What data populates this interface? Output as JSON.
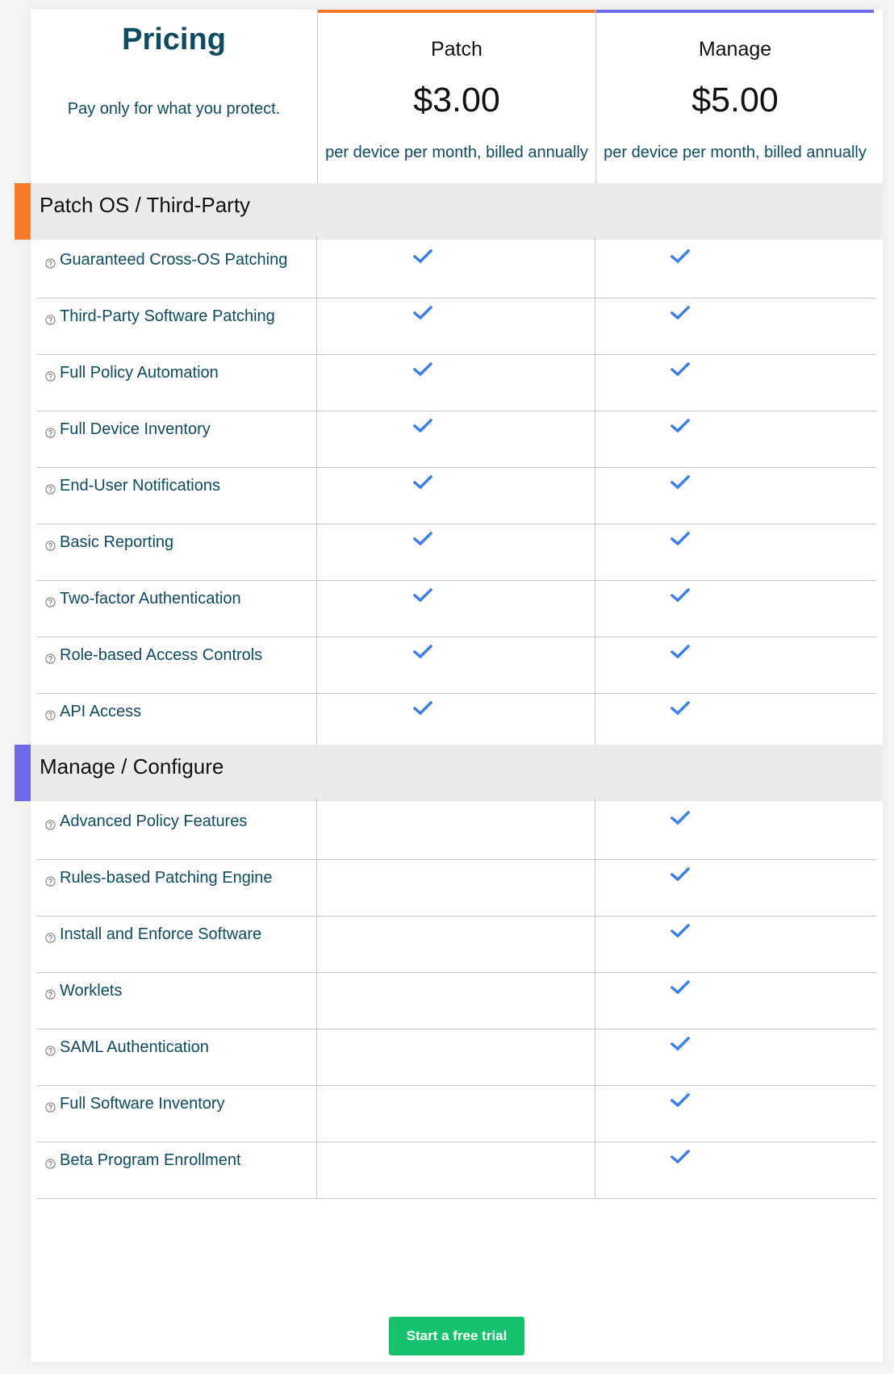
{
  "header": {
    "title": "Pricing",
    "subtitle": "Pay only for what you protect."
  },
  "plans": [
    {
      "name": "Patch",
      "price": "$3.00",
      "note": "per device per month, billed annually",
      "accent": "#f97a2a"
    },
    {
      "name": "Manage",
      "price": "$5.00",
      "note": "per device per month, billed annually",
      "accent": "#6f6be8"
    }
  ],
  "sections": [
    {
      "title": "Patch OS / Third-Party",
      "accent": "#f97a2a",
      "features": [
        {
          "label": "Guaranteed Cross-OS Patching",
          "patch": true,
          "manage": true
        },
        {
          "label": "Third-Party Software Patching",
          "patch": true,
          "manage": true
        },
        {
          "label": "Full Policy Automation",
          "patch": true,
          "manage": true
        },
        {
          "label": "Full Device Inventory",
          "patch": true,
          "manage": true
        },
        {
          "label": "End-User Notifications",
          "patch": true,
          "manage": true
        },
        {
          "label": "Basic Reporting",
          "patch": true,
          "manage": true
        },
        {
          "label": "Two-factor Authentication",
          "patch": true,
          "manage": true
        },
        {
          "label": "Role-based Access Controls",
          "patch": true,
          "manage": true
        },
        {
          "label": "API Access",
          "patch": true,
          "manage": true
        }
      ]
    },
    {
      "title": "Manage / Configure",
      "accent": "#6f6be8",
      "features": [
        {
          "label": "Advanced Policy Features",
          "patch": false,
          "manage": true
        },
        {
          "label": "Rules-based Patching Engine",
          "patch": false,
          "manage": true
        },
        {
          "label": "Install and Enforce Software",
          "patch": false,
          "manage": true
        },
        {
          "label": "Worklets",
          "patch": false,
          "manage": true
        },
        {
          "label": "SAML Authentication",
          "patch": false,
          "manage": true
        },
        {
          "label": "Full Software Inventory",
          "patch": false,
          "manage": true
        },
        {
          "label": "Beta Program Enrollment",
          "patch": false,
          "manage": true
        }
      ]
    }
  ],
  "cta": {
    "label": "Start a free trial"
  },
  "colors": {
    "check": "#3b7de9",
    "cta": "#17c26e",
    "text": "#0e4a62"
  }
}
